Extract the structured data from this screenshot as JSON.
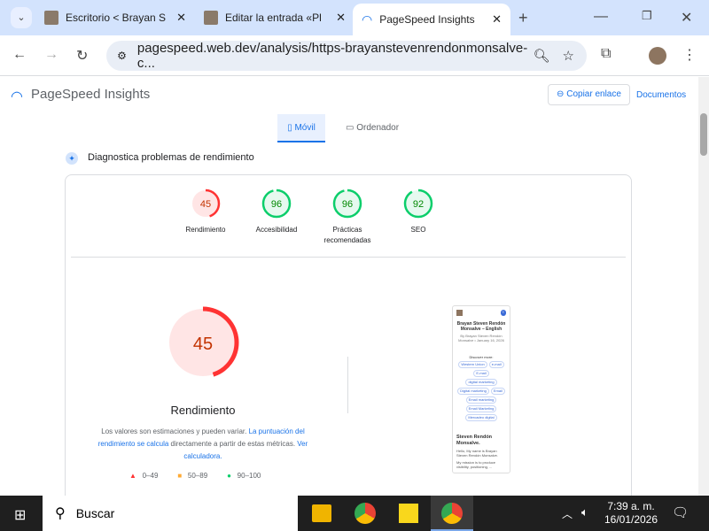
{
  "browser": {
    "tabs": [
      {
        "title": "Escritorio < Brayan S"
      },
      {
        "title": "Editar la entrada «Pl"
      },
      {
        "title": "PageSpeed Insights"
      }
    ],
    "url": "pagespeed.web.dev/analysis/https-brayanstevenrendonmonsalve-c..."
  },
  "header": {
    "title": "PageSpeed Insights",
    "copy_link": "Copiar enlace",
    "docs": "Documentos"
  },
  "device_tabs": [
    {
      "label": "Móvil"
    },
    {
      "label": "Ordenador"
    }
  ],
  "section_title": "Diagnostica problemas de rendimiento",
  "scores": [
    {
      "label": "Rendimiento",
      "value": 45,
      "color": "#ff3333"
    },
    {
      "label": "Accesibilidad",
      "value": 96,
      "color": "#0cce6b"
    },
    {
      "label": "Prácticas recomendadas",
      "value": 96,
      "color": "#0cce6b"
    },
    {
      "label": "SEO",
      "value": 92,
      "color": "#0cce6b"
    }
  ],
  "main_score": {
    "value": 45,
    "label": "Rendimiento"
  },
  "note": {
    "p1": "Los valores son estimaciones y pueden variar. ",
    "p2": "La puntuación del rendimiento se calcula",
    "p3": " directamente a partir de estas métricas. ",
    "p4": "Ver calculadora."
  },
  "legend": [
    {
      "range": "0–49",
      "color": "#ff3333"
    },
    {
      "range": "50–89",
      "color": "#ffaa33"
    },
    {
      "range": "90–100",
      "color": "#0cce6b"
    }
  ],
  "screenshot": {
    "title": "Brayan Steven Rendón Monsalve – English",
    "byline": "By Brayan Steven Rendón Monsalve • January 16, 2026",
    "discover": "Discover more:",
    "chips": [
      "Western Union",
      "e-mail",
      "E-mail",
      "digital marketing",
      "Digital marketing",
      "Email",
      "Email marketing",
      "Email Marketing",
      "Mercadeo digital"
    ],
    "heading": "Steven Rendón Monsalve.",
    "p1": "Hello, My name is Brayan Steven Rendón Monsalve.",
    "p2": "My mission is to produce visibility, positioning, ..."
  },
  "taskbar": {
    "search": "Buscar",
    "time": "7:39 a. m.",
    "date": "16/01/2026"
  }
}
